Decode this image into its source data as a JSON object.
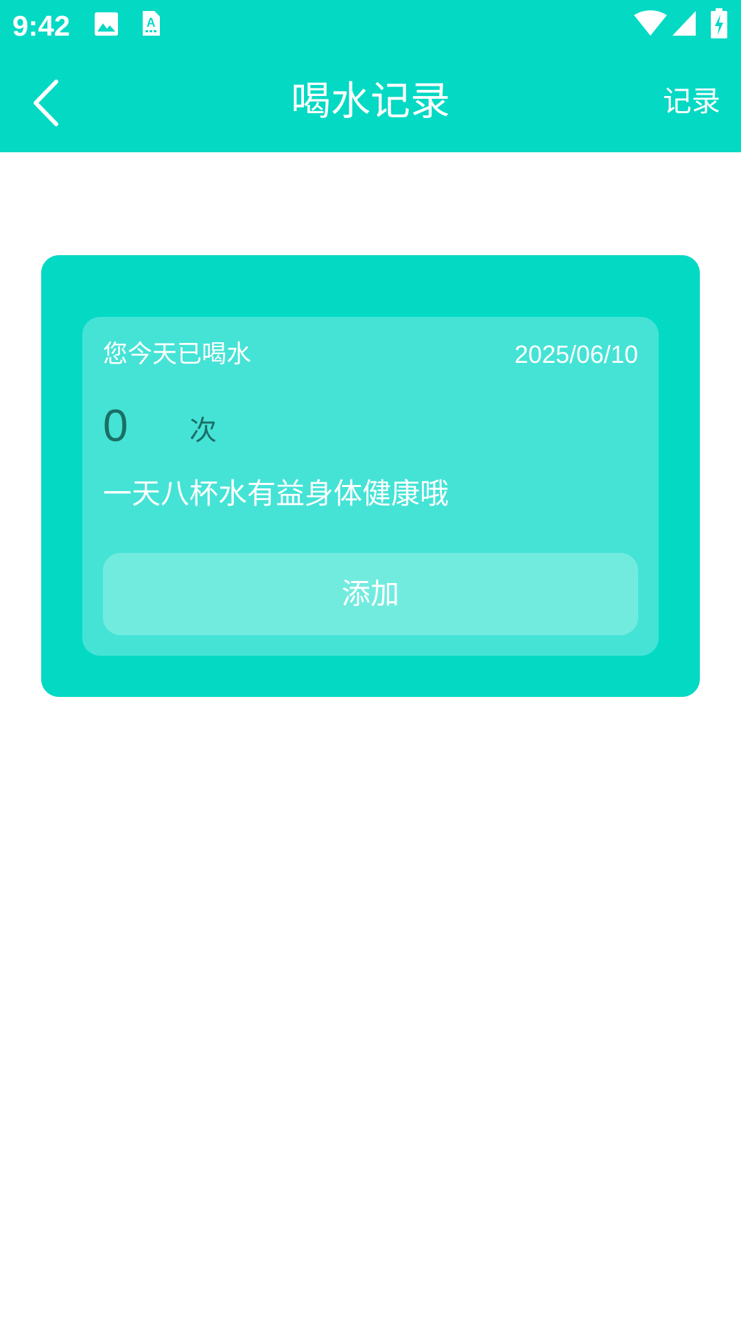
{
  "status_bar": {
    "time": "9:42",
    "icons": [
      "image-icon",
      "text-a-icon",
      "wifi-icon",
      "signal-icon",
      "battery-charging-icon"
    ]
  },
  "toolbar": {
    "back_icon": "chevron-left-icon",
    "title": "喝水记录",
    "action": "记录"
  },
  "card": {
    "label": "您今天已喝水",
    "date": "2025/06/10",
    "count": "0",
    "unit": "次",
    "tip": "一天八杯水有益身体健康哦",
    "add_button": "添加"
  },
  "colors": {
    "accent": "#04d9c4",
    "inner_card": "#45e3d6",
    "button": "#72ebdf",
    "count_text": "#1b6f66"
  }
}
